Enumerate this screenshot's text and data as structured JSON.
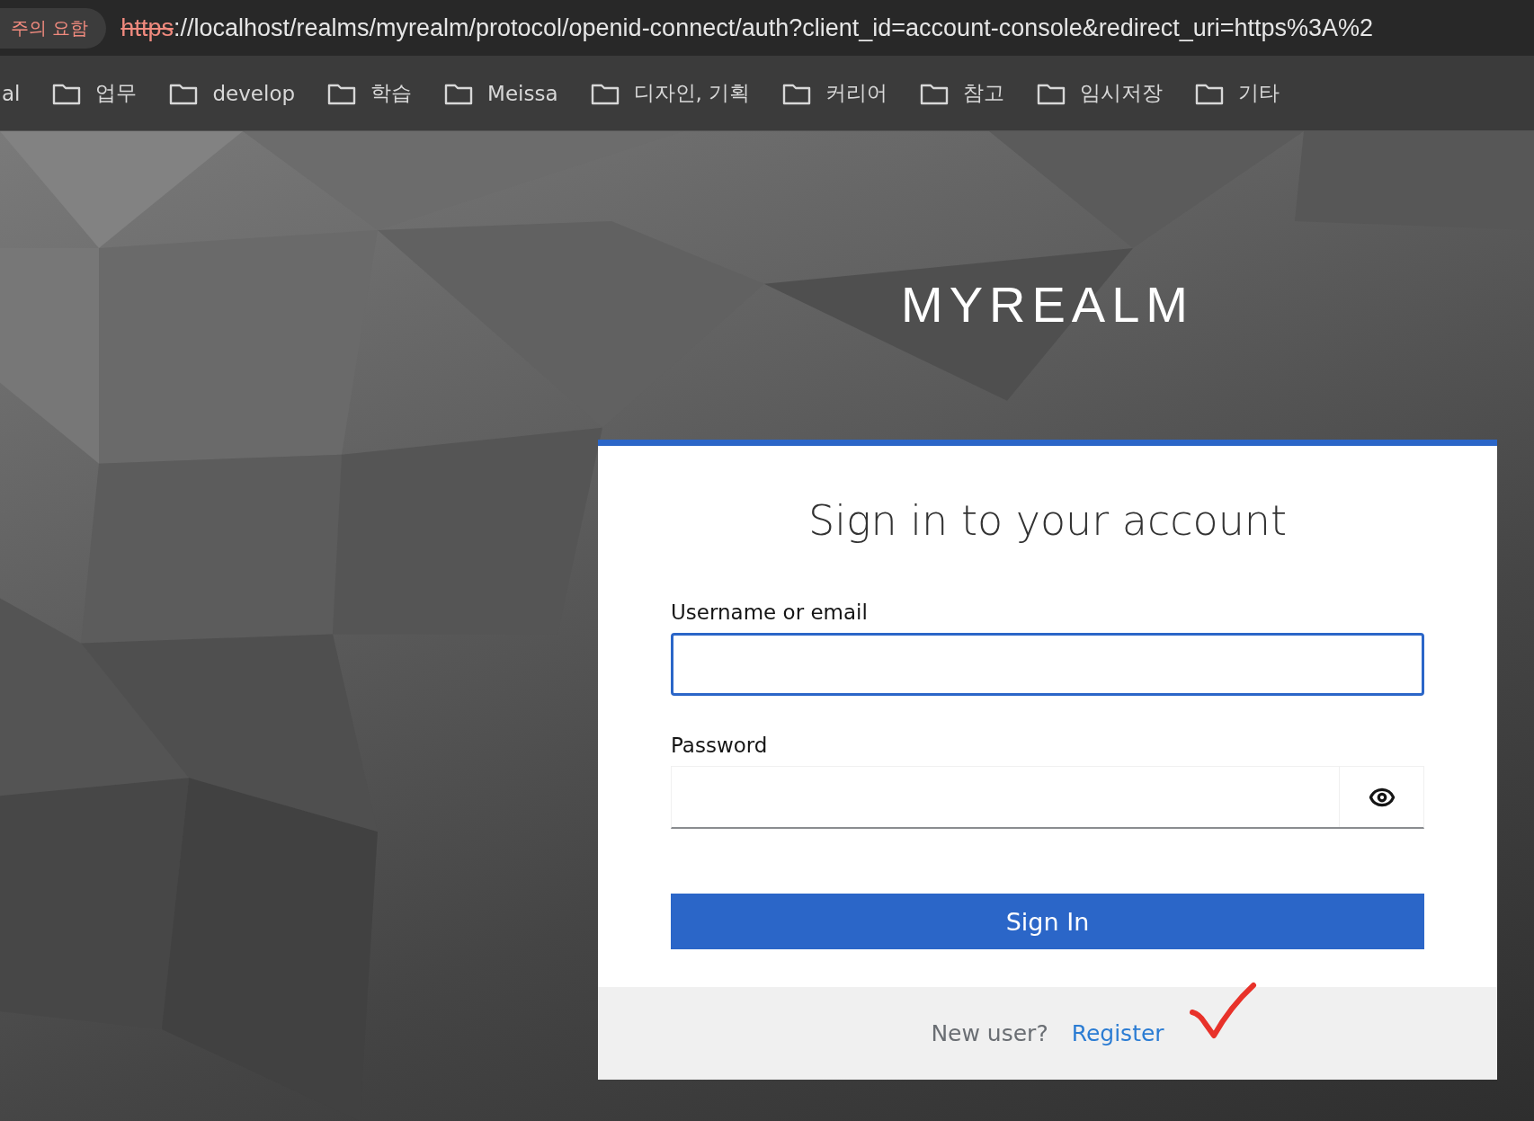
{
  "address_bar": {
    "security_badge": "주의 요함",
    "insecure": true,
    "scheme": "https",
    "rest": "://localhost/realms/myrealm/protocol/openid-connect/auth?client_id=account-console&redirect_uri=https%3A%2"
  },
  "bookmarks": [
    {
      "label": "al",
      "kind": "text"
    },
    {
      "label": "업무",
      "kind": "folder"
    },
    {
      "label": "develop",
      "kind": "folder"
    },
    {
      "label": "학습",
      "kind": "folder"
    },
    {
      "label": "Meissa",
      "kind": "folder"
    },
    {
      "label": "디자인, 기획",
      "kind": "folder"
    },
    {
      "label": "커리어",
      "kind": "folder"
    },
    {
      "label": "참고",
      "kind": "folder"
    },
    {
      "label": "임시저장",
      "kind": "folder"
    },
    {
      "label": "기타",
      "kind": "folder"
    }
  ],
  "realm": "MYREALM",
  "login": {
    "title": "Sign in to your account",
    "fields": [
      {
        "label": "Username or email",
        "kind": "text",
        "focused": true
      },
      {
        "label": "Password",
        "kind": "password",
        "focused": false
      }
    ],
    "submit": "Sign In",
    "footer": {
      "prompt": "New user?",
      "link": "Register"
    }
  }
}
